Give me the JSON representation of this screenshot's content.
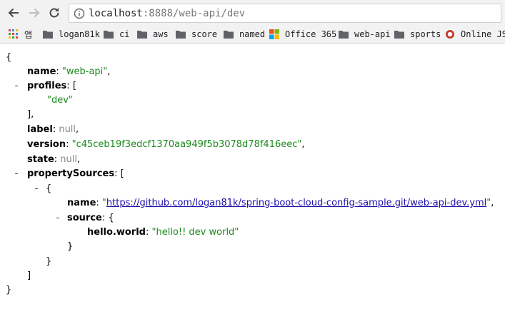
{
  "browser": {
    "url_host": "localhost",
    "url_rest": ":8888/web-api/dev",
    "bookmarks": {
      "apps": "앱",
      "logan81k": "logan81k",
      "ci": "ci",
      "aws": "aws",
      "score": "score",
      "named": "named",
      "office365": "Office 365",
      "webapi": "web-api",
      "sports": "sports",
      "onlinejson": "Online JSON"
    }
  },
  "json": {
    "open_brace": "{",
    "close_brace": "}",
    "open_bracket": "[",
    "close_bracket": "]",
    "close_bracket_comma": "],",
    "open_brace_inner": "{",
    "close_brace_inner": "}",
    "colon": ": ",
    "comma": ",",
    "toggle": "-",
    "keys": {
      "name": "name",
      "profiles": "profiles",
      "label": "label",
      "version": "version",
      "state": "state",
      "propertySources": "propertySources",
      "ps_name": "name",
      "source": "source",
      "hello_world": "hello.world"
    },
    "values": {
      "name": "\"web-api\"",
      "profile_0": "\"dev\"",
      "label": "null",
      "version": "\"c45ceb19f3edcf1370aa949f5b3078d78f416eec\"",
      "state": "null",
      "ps_name_quote_open": "\"",
      "ps_name_link": "https://github.com/logan81k/spring-boot-cloud-config-sample.git/web-api-dev.yml",
      "ps_name_quote_close": "\"",
      "hello_world": "\"hello!! dev world\""
    }
  }
}
